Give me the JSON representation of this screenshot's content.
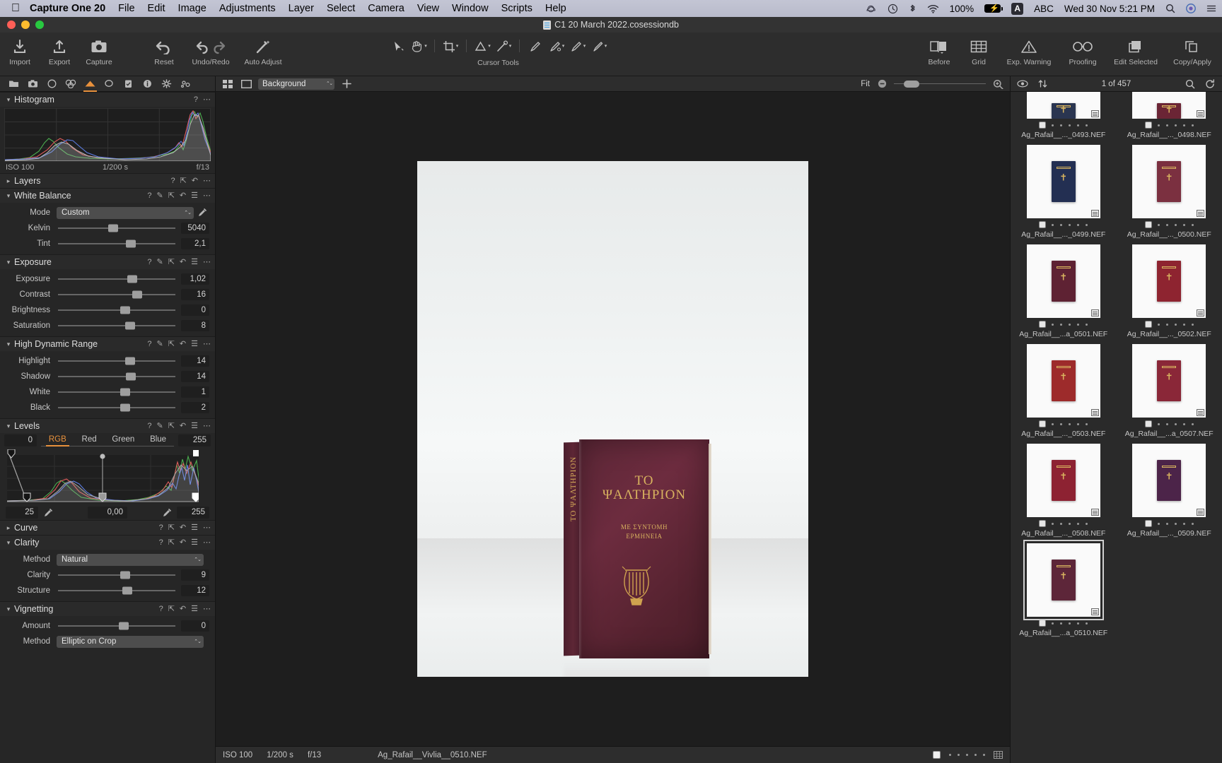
{
  "menubar": {
    "apple_icon": "apple-logo-icon",
    "app_name": "Capture One 20",
    "items": [
      "File",
      "Edit",
      "Image",
      "Adjustments",
      "Layer",
      "Select",
      "Camera",
      "View",
      "Window",
      "Scripts",
      "Help"
    ],
    "status": {
      "creative_cloud_icon": "creative-cloud-icon",
      "time_machine_icon": "time-machine-icon",
      "bluetooth_icon": "bluetooth-icon",
      "wifi_icon": "wifi-icon",
      "battery_percent": "100%",
      "battery_icon": "battery-charging-icon",
      "input_source_badge": "A",
      "input_source": "ABC",
      "datetime": "Wed 30 Nov 5:21 PM",
      "search_icon": "spotlight-search-icon",
      "siri_icon": "siri-icon",
      "control_center_icon": "control-center-icon"
    }
  },
  "titlebar": {
    "document_title": "C1 20 March 2022.cosessiondb",
    "doc_icon": "session-document-icon"
  },
  "toolbar": {
    "left_items": [
      {
        "label": "Import",
        "icon": "import-arrow-down-icon"
      },
      {
        "label": "Export",
        "icon": "export-arrow-up-icon"
      },
      {
        "label": "Capture",
        "icon": "camera-icon"
      }
    ],
    "edit_items": [
      {
        "label": "Reset",
        "icon": "reset-undo-icon"
      },
      {
        "label": "Undo/Redo",
        "icon": "undo-redo-icon"
      },
      {
        "label": "Auto Adjust",
        "icon": "magic-wand-icon"
      }
    ],
    "cursor_tools_label": "Cursor Tools",
    "cursor_tools": [
      "pointer-select-icon",
      "pan-hand-icon",
      "crop-icon",
      "straighten-icon",
      "spot-removal-icon",
      "draw-mask-icon",
      "heal-brush-icon",
      "clone-brush-icon",
      "erase-brush-icon"
    ],
    "right_items": [
      {
        "label": "Before",
        "icon": "before-after-icon"
      },
      {
        "label": "Grid",
        "icon": "grid-icon"
      },
      {
        "label": "Exp. Warning",
        "icon": "exposure-warning-icon"
      },
      {
        "label": "Proofing",
        "icon": "proofing-glasses-icon"
      },
      {
        "label": "Edit Selected",
        "icon": "edit-selected-icon"
      },
      {
        "label": "Copy/Apply",
        "icon": "copy-apply-icon"
      }
    ]
  },
  "tool_tabs": [
    {
      "name": "library-tab",
      "icon": "folder-icon",
      "active": false
    },
    {
      "name": "capture-tab",
      "icon": "camera-icon",
      "active": false
    },
    {
      "name": "lens-tab",
      "icon": "lens-icon",
      "active": false
    },
    {
      "name": "color-tab",
      "icon": "color-wheels-icon",
      "active": false
    },
    {
      "name": "exposure-tab",
      "icon": "exposure-icon",
      "active": true
    },
    {
      "name": "details-tab",
      "icon": "magnifier-icon",
      "active": false
    },
    {
      "name": "adjustments-tab",
      "icon": "clipboard-check-icon",
      "active": false
    },
    {
      "name": "metadata-tab",
      "icon": "info-icon",
      "active": false
    },
    {
      "name": "output-tab",
      "icon": "gear-icon",
      "active": false
    },
    {
      "name": "batch-tab",
      "icon": "gears-icon",
      "active": false
    }
  ],
  "panels": {
    "histogram": {
      "title": "Histogram",
      "iso": "ISO 100",
      "shutter": "1/200 s",
      "aperture": "f/13"
    },
    "layers": {
      "title": "Layers",
      "collapsed": true
    },
    "white_balance": {
      "title": "White Balance",
      "mode_label": "Mode",
      "mode_value": "Custom",
      "sliders": [
        {
          "label": "Kelvin",
          "value": "5040",
          "pos": 47
        },
        {
          "label": "Tint",
          "value": "2,1",
          "pos": 62
        }
      ]
    },
    "exposure": {
      "title": "Exposure",
      "sliders": [
        {
          "label": "Exposure",
          "value": "1,02",
          "pos": 63
        },
        {
          "label": "Contrast",
          "value": "16",
          "pos": 67
        },
        {
          "label": "Brightness",
          "value": "0",
          "pos": 57
        },
        {
          "label": "Saturation",
          "value": "8",
          "pos": 61
        }
      ]
    },
    "hdr": {
      "title": "High Dynamic Range",
      "sliders": [
        {
          "label": "Highlight",
          "value": "14",
          "pos": 61
        },
        {
          "label": "Shadow",
          "value": "14",
          "pos": 62
        },
        {
          "label": "White",
          "value": "1",
          "pos": 57
        },
        {
          "label": "Black",
          "value": "2",
          "pos": 57
        }
      ]
    },
    "levels": {
      "title": "Levels",
      "left_value": "0",
      "right_value": "255",
      "channels": [
        "RGB",
        "Red",
        "Green",
        "Blue"
      ],
      "active_channel": "RGB",
      "black_point": "25",
      "gamma": "0,00",
      "white_point": "255",
      "picker_icon": "eyedropper-icon"
    },
    "curve": {
      "title": "Curve",
      "collapsed": true
    },
    "clarity": {
      "title": "Clarity",
      "method_label": "Method",
      "method_value": "Natural",
      "sliders": [
        {
          "label": "Clarity",
          "value": "9",
          "pos": 57
        },
        {
          "label": "Structure",
          "value": "12",
          "pos": 59
        }
      ]
    },
    "vignetting": {
      "title": "Vignetting",
      "sliders": [
        {
          "label": "Amount",
          "value": "0",
          "pos": 56
        }
      ],
      "method_label": "Method",
      "method_value": "Elliptic on Crop"
    },
    "section_icons": {
      "help": "?",
      "picker": "eyedropper-icon",
      "expand": "expand-arrows-icon",
      "reset": "reset-arrow-icon",
      "menu": "hamburger-menu-icon",
      "more": "more-options-icon"
    }
  },
  "viewer": {
    "toolbar": {
      "multi_view_icon": "multi-view-icon",
      "single_view_icon": "single-view-icon",
      "background_value": "Background",
      "add_icon": "add-plus-icon",
      "zoom_label": "Fit",
      "zoom_out_icon": "zoom-out-icon",
      "zoom_in_icon": "zoom-in-icon"
    },
    "image": {
      "book_title_line1": "ΤΟ",
      "book_title_line2": "ΨΑΛΤΗΡΙΟΝ",
      "book_subtitle_line1": "ΜΕ ΣΥΝΤΟΜΗ",
      "book_subtitle_line2": "ΕΡΜΗΝΕΙΑ",
      "spine_text": "ΤΟ ΨΑΛΤΗΡΙΟΝ",
      "emblem_icon": "lyre-harp-emblem-icon"
    },
    "status": {
      "iso": "ISO 100",
      "shutter": "1/200 s",
      "aperture": "f/13",
      "filename": "Ag_Rafail__Vivlia__0510.NEF",
      "grid_icon": "grid-view-icon"
    }
  },
  "browser": {
    "toolbar": {
      "eye_icon": "visibility-eye-icon",
      "sort_icon": "sort-arrows-icon",
      "count_label": "1 of 457",
      "search_icon": "search-icon",
      "refresh_icon": "refresh-icon"
    },
    "thumbnails": [
      {
        "filename": "Ag_Rafail__..._0493.NEF",
        "color": "#2a3550",
        "partial": true,
        "selected": false
      },
      {
        "filename": "Ag_Rafail__..._0498.NEF",
        "color": "#6b2535",
        "partial": true,
        "selected": false
      },
      {
        "filename": "Ag_Rafail__..._0499.NEF",
        "color": "#232f52",
        "partial": false,
        "selected": false
      },
      {
        "filename": "Ag_Rafail__..._0500.NEF",
        "color": "#7b3040",
        "partial": false,
        "selected": false
      },
      {
        "filename": "Ag_Rafail__...a_0501.NEF",
        "color": "#5e2233",
        "partial": false,
        "selected": false
      },
      {
        "filename": "Ag_Rafail__..._0502.NEF",
        "color": "#8e2430",
        "partial": false,
        "selected": false
      },
      {
        "filename": "Ag_Rafail__..._0503.NEF",
        "color": "#9d2b2b",
        "partial": false,
        "selected": false
      },
      {
        "filename": "Ag_Rafail__...a_0507.NEF",
        "color": "#8a2738",
        "partial": false,
        "selected": false
      },
      {
        "filename": "Ag_Rafail__..._0508.NEF",
        "color": "#8d2232",
        "partial": false,
        "selected": false
      },
      {
        "filename": "Ag_Rafail__..._0509.NEF",
        "color": "#4c2449",
        "partial": false,
        "selected": false
      },
      {
        "filename": "Ag_Rafail__...a_0510.NEF",
        "color": "#5d2639",
        "partial": false,
        "selected": true
      }
    ]
  },
  "colors": {
    "accent": "#e8913c",
    "panel_bg": "#262626",
    "toolbar_bg": "#2d2d2d",
    "viewer_bg": "#1e1e1e"
  }
}
